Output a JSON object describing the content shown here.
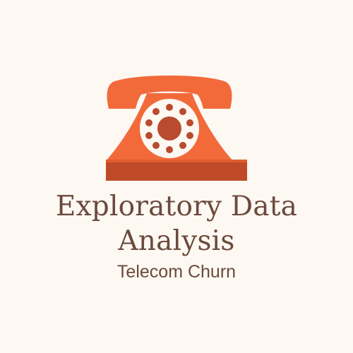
{
  "colors": {
    "background": "#fdf8f2",
    "phone_orange": "#f26a3a",
    "phone_dark": "#bf4a28",
    "dial_face": "#fdf8f2",
    "dial_holes": "#b94b2e",
    "text": "#6b4a3d"
  },
  "logo": {
    "icon": "rotary-phone-icon"
  },
  "title": {
    "line1": "Exploratory Data",
    "line2": "Analysis"
  },
  "subtitle": "Telecom Churn"
}
